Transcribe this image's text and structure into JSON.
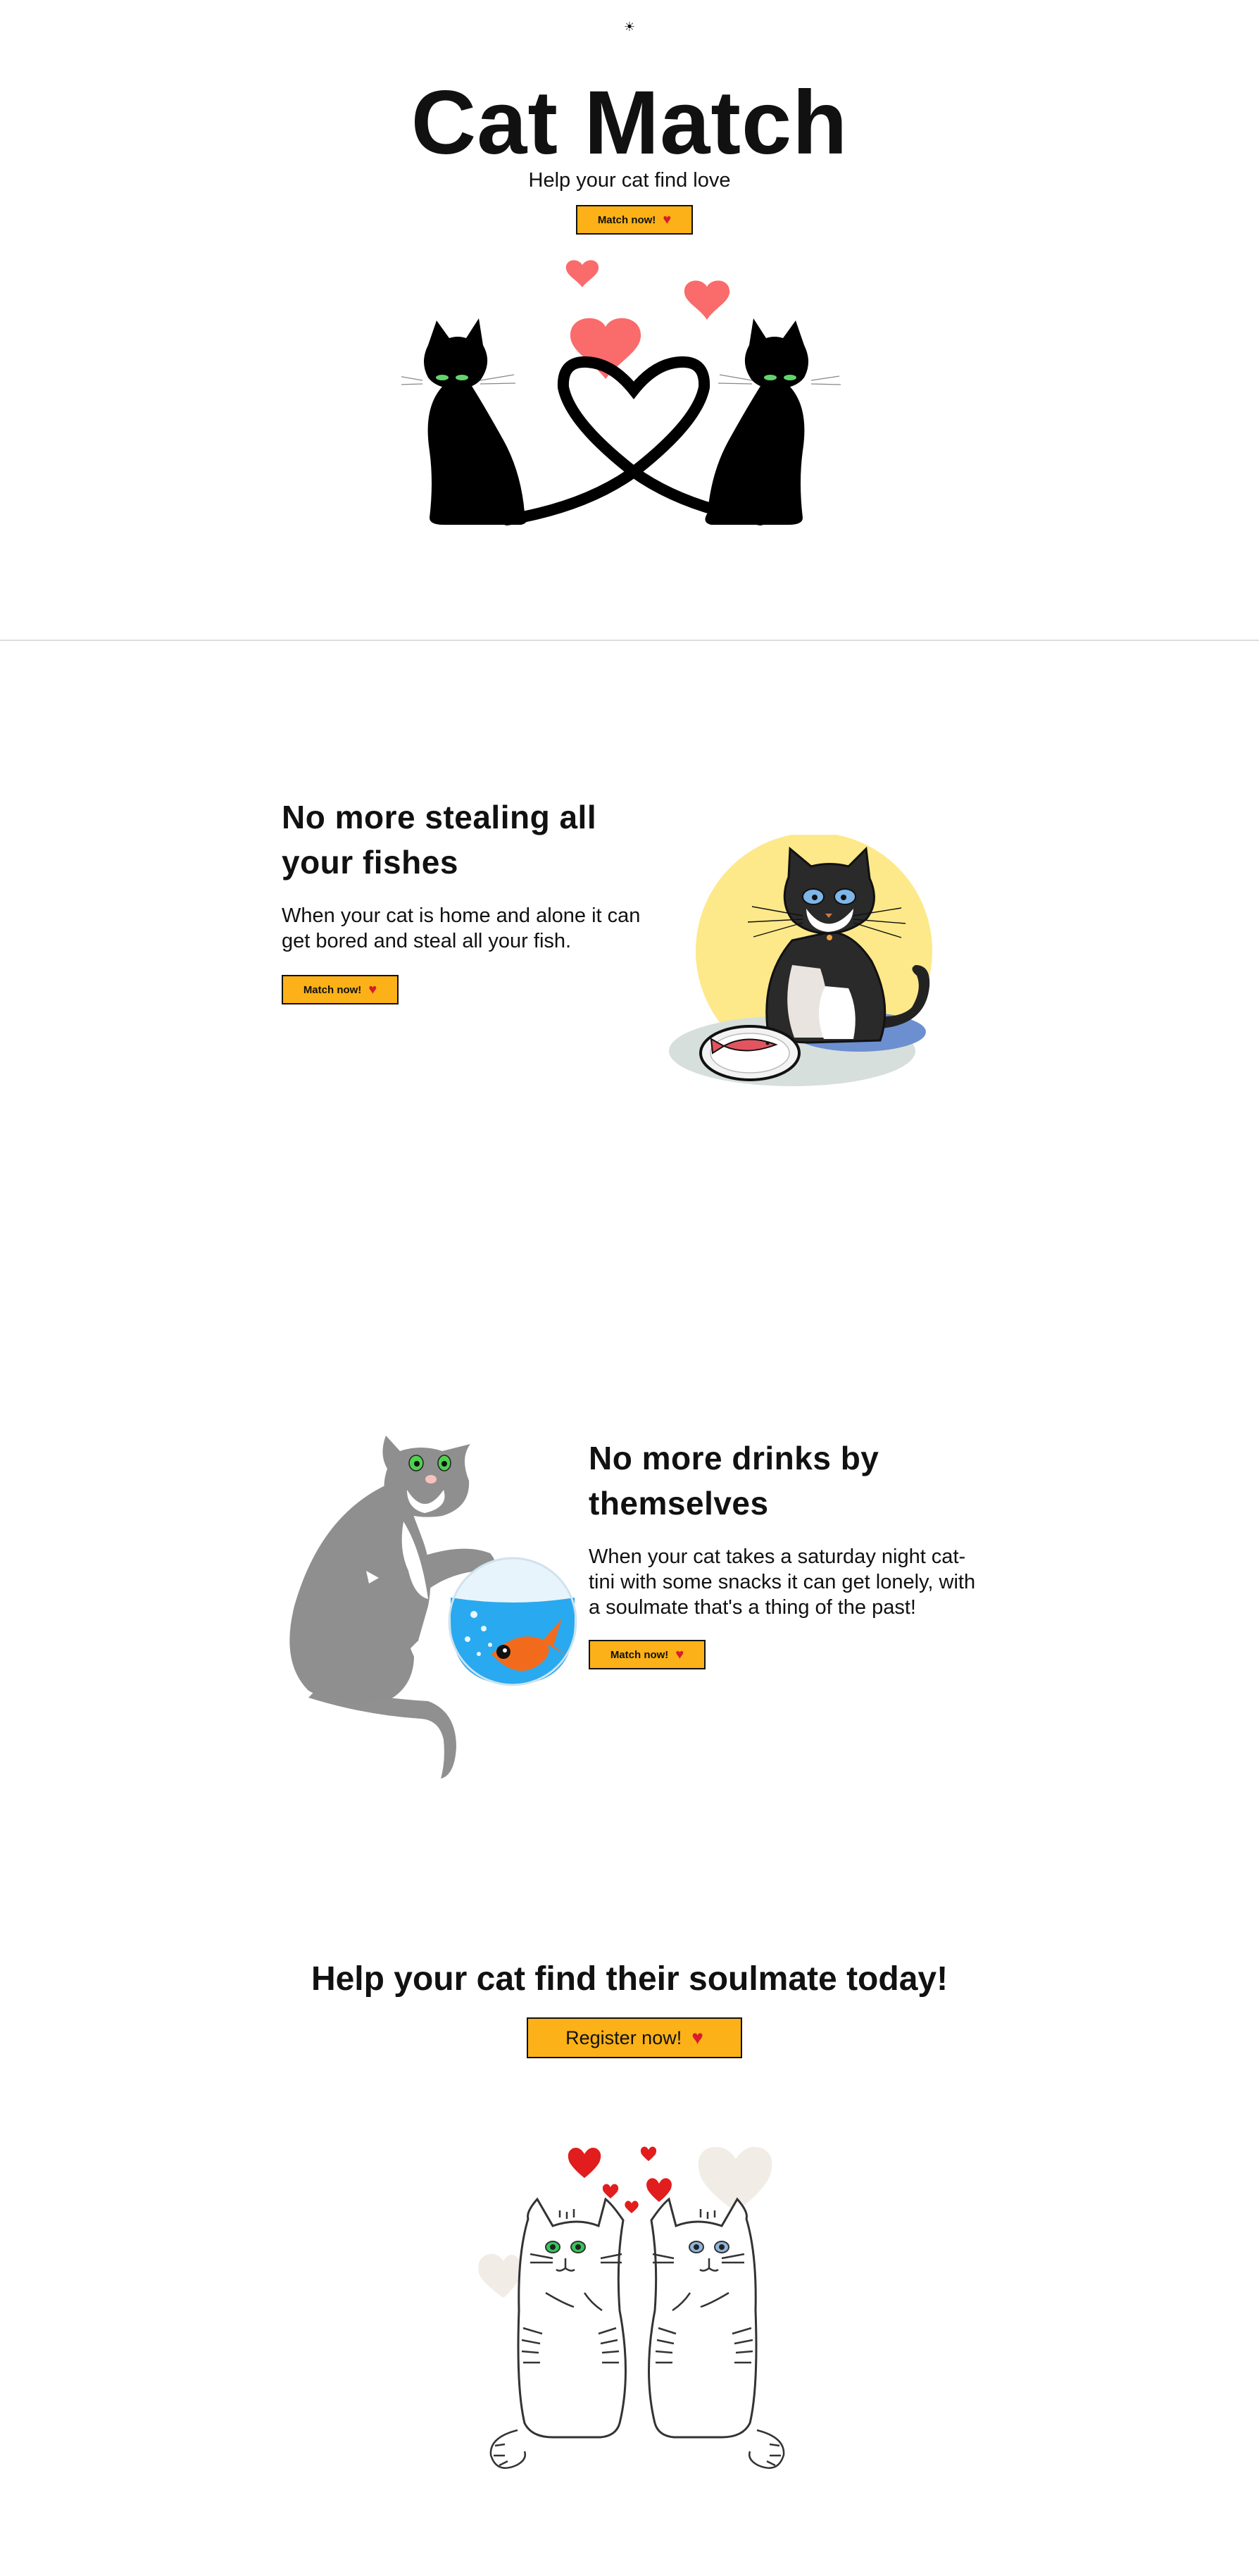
{
  "header": {
    "theme_toggle_icon": "☀"
  },
  "hero": {
    "title": "Cat Match",
    "subtitle": "Help your cat find love",
    "button_label": "Match now!",
    "button_icon": "♥"
  },
  "sections": [
    {
      "title": "No more stealing all your fishes",
      "text": "When your cat is home and alone it can get bored and steal all your fish.",
      "button_label": "Match now!",
      "button_icon": "♥"
    },
    {
      "title": "No more drinks by themselves",
      "text": "When your cat takes a saturday night cat-tini with some snacks it can get lonely, with a soulmate that's a thing of the past!",
      "button_label": "Match now!",
      "button_icon": "♥"
    }
  ],
  "cta": {
    "title": "Help your cat find their soulmate today!",
    "button_label": "Register now!",
    "button_icon": "♥"
  },
  "colors": {
    "accent": "#fbb117",
    "heart": "#d81b2f",
    "hero_hearts": "#fa6b6b",
    "text": "#111111",
    "divider": "#dddddd"
  }
}
